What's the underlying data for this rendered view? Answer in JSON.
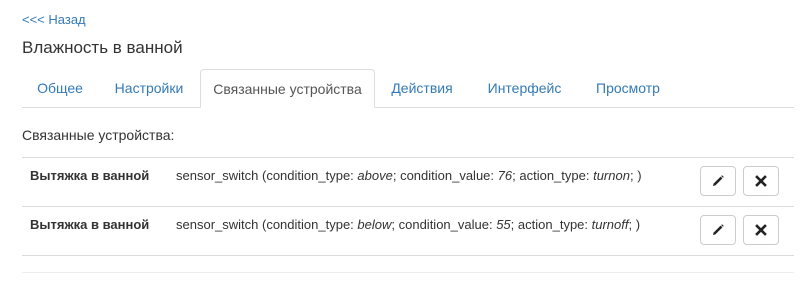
{
  "nav": {
    "back_label": "<<< Назад"
  },
  "page": {
    "title": "Влажность в ванной"
  },
  "tabs": [
    {
      "label": "Общее",
      "active": false
    },
    {
      "label": "Настройки",
      "active": false
    },
    {
      "label": "Связанные устройства",
      "active": true
    },
    {
      "label": "Действия",
      "active": false
    },
    {
      "label": "Интерфейс",
      "active": false
    },
    {
      "label": "Просмотр",
      "active": false
    }
  ],
  "linked": {
    "section_label": "Связанные устройства:",
    "rows": [
      {
        "name": "Вытяжка в ванной",
        "module": "sensor_switch",
        "condition_type": "above",
        "condition_value": "76",
        "action_type": "turnon"
      },
      {
        "name": "Вытяжка в ванной",
        "module": "sensor_switch",
        "condition_type": "below",
        "condition_value": "55",
        "action_type": "turnoff"
      }
    ],
    "keys": {
      "condition_type": "condition_type",
      "condition_value": "condition_value",
      "action_type": "action_type"
    },
    "icons": {
      "edit": "pencil-icon",
      "delete": "close-icon"
    }
  },
  "colors": {
    "link": "#337ab7",
    "border": "#dddddd",
    "text": "#333333"
  }
}
